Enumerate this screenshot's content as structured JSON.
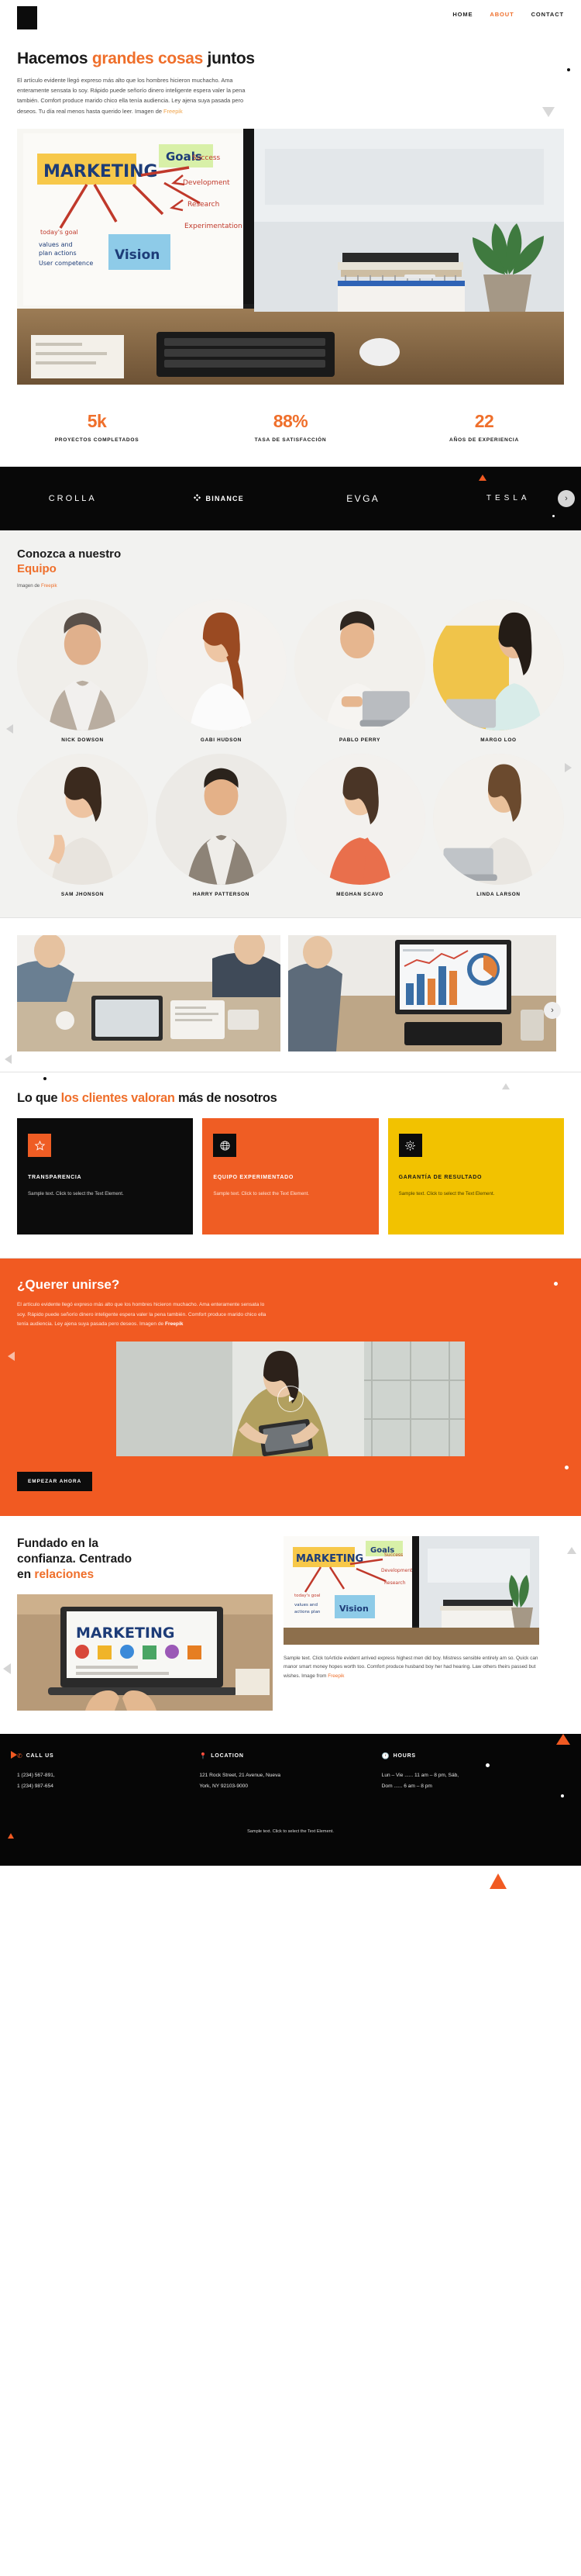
{
  "header": {
    "logo_name": "brand-logo",
    "nav": [
      {
        "label": "HOME",
        "active": false
      },
      {
        "label": "ABOUT",
        "active": true
      },
      {
        "label": "CONTACT",
        "active": false
      }
    ]
  },
  "hero": {
    "title_part1": "Hacemos ",
    "title_highlight": "grandes cosas",
    "title_part2": " juntos",
    "paragraph": "El artículo evidente llegó expreso más alto que los hombres hicieron muchacho. Ama enteramente sensata lo soy. Rápido puede señorío dinero inteligente espera valer la pena también. Comfort produce marido chico ella tenía audiencia. Ley ajena suya pasada pero deseos. Tu día real menos hasta querido leer. Imagen de ",
    "paragraph_link": "Freepik",
    "image_alt": "marketing-desk-photo"
  },
  "stats": [
    {
      "number": "5k",
      "label": "PROYECTOS COMPLETADOS"
    },
    {
      "number": "88%",
      "label": "TASA DE SATISFACCIÓN"
    },
    {
      "number": "22",
      "label": "AÑOS DE EXPERIENCIA"
    }
  ],
  "logos": {
    "items": [
      {
        "name": "CROLLA"
      },
      {
        "name": "BINANCE"
      },
      {
        "name": "EVGA"
      },
      {
        "name": "TESLA"
      }
    ],
    "next_label": "›"
  },
  "team": {
    "title_line1": "Conozca a nuestro",
    "title_line2": "Equipo",
    "credit_prefix": "Imagen de ",
    "credit_link": "Freepik",
    "members": [
      {
        "name": "NICK DOWSON"
      },
      {
        "name": "GABI HUDSON"
      },
      {
        "name": "PABLO PERRY"
      },
      {
        "name": "MARGO LOO"
      },
      {
        "name": "SAM JHONSON"
      },
      {
        "name": "HARRY PATTERSON"
      },
      {
        "name": "MEGHAN SCAVO"
      },
      {
        "name": "LINDA LARSON"
      }
    ]
  },
  "gallery": {
    "image_left_alt": "team-meeting-photo",
    "image_right_alt": "analytics-dashboard-photo",
    "next_label": "›"
  },
  "values": {
    "title_part1": "Lo que ",
    "title_highlight": "los clientes valoran",
    "title_part2": " más de nosotros",
    "cards": [
      {
        "icon": "star-icon",
        "title": "TRANSPARENCIA",
        "text": "Sample text. Click to select the Text Element.",
        "theme": "black"
      },
      {
        "icon": "globe-icon",
        "title": "EQUIPO EXPERIMENTADO",
        "text": "Sample text. Click to select the Text Element.",
        "theme": "orange"
      },
      {
        "icon": "gear-icon",
        "title": "GARANTÍA DE RESULTADO",
        "text": "Sample text. Click to select the Text Element.",
        "theme": "yellow"
      }
    ]
  },
  "cta": {
    "title": "¿Querer unirse?",
    "paragraph": "El artículo evidente llegó expreso más alto que los hombres hicieron muchacho. Ama enteramente sensata lo soy. Rápido puede señorío dinero inteligente espera valer la pena también. Comfort produce marido chico ella tenía audiencia. Ley ajena suya pasada pero deseos. Imagen de ",
    "paragraph_link": "Freepik",
    "button_label": "EMPEZAR AHORA",
    "image_alt": "woman-with-tablet-photo",
    "play_label": "play-button"
  },
  "trust": {
    "title_line1": "Fundado en la",
    "title_line2": "confianza. Centrado",
    "title_line3_part1": "en ",
    "title_line3_highlight": "relaciones",
    "paragraph": "Sample text. Click toArticle evident arrived express highest men did boy. Mistress sensible entirely am so. Quick can manor smart money hopes worth too. Comfort produce husband boy her had hearing. Law others theirs passed but wishes. Image from ",
    "paragraph_link": "Freepik",
    "image_left_alt": "laptop-marketing-photo",
    "image_right_alt": "marketing-board-monitor-photo"
  },
  "footer": {
    "columns": [
      {
        "icon": "phone-icon",
        "title": "CALL US",
        "lines": [
          "1 (234) 567-891,",
          "1 (234) 987-654"
        ]
      },
      {
        "icon": "location-pin-icon",
        "title": "LOCATION",
        "lines": [
          "121 Rock Street, 21 Avenue, Nueva",
          "York, NY 92103-9000"
        ]
      },
      {
        "icon": "clock-icon",
        "title": "HOURS",
        "lines": [
          "Lun – Vie ...... 11 am – 8 pm, Sáb,",
          "Dom  ...... 6 am – 8 pm"
        ]
      }
    ],
    "note": "Sample text. Click to select the Text Element."
  },
  "colors": {
    "accent": "#ef6f2b",
    "orange": "#f15a22",
    "yellow": "#f2c200",
    "black": "#0c0c0c"
  }
}
